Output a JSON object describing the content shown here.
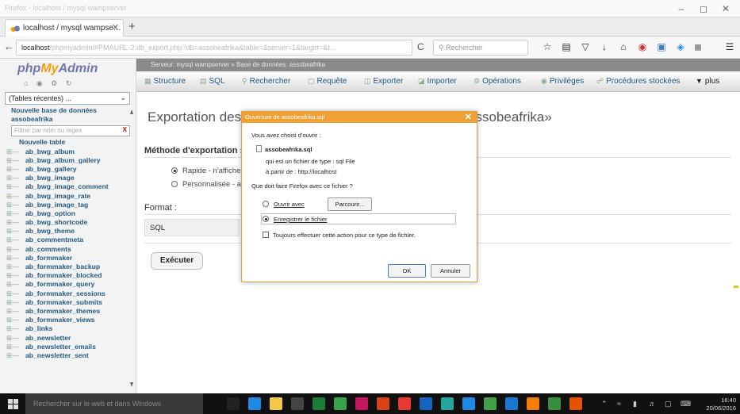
{
  "window": {
    "title": "Firefox - localhost / mysql wampserver",
    "controls": [
      "–",
      "◻",
      "✕"
    ]
  },
  "tab": {
    "title": "localhost / mysql wampse…",
    "close": "✕",
    "new_tab": "+"
  },
  "nav": {
    "back": "←",
    "url_host": "localhost",
    "url_rest": "/phpmyadmin/#PMAURL-2:db_export.php?db=assobeafrika&table=&server=1&target=&t…",
    "reload": "C",
    "search_placeholder": "Rechercher",
    "toolbar_icons": [
      "star-icon",
      "library-icon",
      "pocket-icon",
      "download-icon",
      "home-icon",
      "extension-icon",
      "extension2-icon",
      "extension3-icon",
      "menu-icon"
    ]
  },
  "sidebar": {
    "logo_php": "php",
    "logo_my": "My",
    "logo_admin": "Admin",
    "recent_label": "(Tables récentes) ...",
    "recent_chev": "⌄",
    "new_db": "Nouvelle base de données",
    "db_name": "assobeafrika",
    "filter_placeholder": "Filtrer par nom ou regex",
    "filter_clear": "X",
    "new_table": "Nouvelle table",
    "tables": [
      "ab_bwg_album",
      "ab_bwg_album_gallery",
      "ab_bwg_gallery",
      "ab_bwg_image",
      "ab_bwg_image_comment",
      "ab_bwg_image_rate",
      "ab_bwg_image_tag",
      "ab_bwg_option",
      "ab_bwg_shortcode",
      "ab_bwg_theme",
      "ab_commentmeta",
      "ab_comments",
      "ab_formmaker",
      "ab_formmaker_backup",
      "ab_formmaker_blocked",
      "ab_formmaker_query",
      "ab_formmaker_sessions",
      "ab_formmaker_submits",
      "ab_formmaker_themes",
      "ab_formmaker_views",
      "ab_links",
      "ab_newsletter",
      "ab_newsletter_emails",
      "ab_newsletter_sent"
    ]
  },
  "main": {
    "breadcrumb": "Serveur: mysql wampserver » Base de données: assobeafrika",
    "tabs": [
      {
        "label": "Structure",
        "icon": "structure-icon"
      },
      {
        "label": "SQL",
        "icon": "sql-icon"
      },
      {
        "label": "Rechercher",
        "icon": "search-icon"
      },
      {
        "label": "Requête",
        "icon": "query-icon"
      },
      {
        "label": "Exporter",
        "icon": "export-icon"
      },
      {
        "label": "Importer",
        "icon": "import-icon"
      },
      {
        "label": "Opérations",
        "icon": "operations-icon"
      },
      {
        "label": "Privilèges",
        "icon": "privileges-icon"
      },
      {
        "label": "Procédures stockées",
        "icon": "procedures-icon"
      },
      {
        "label": "plus",
        "icon": "more-icon"
      }
    ],
    "title_left": "Exportation des",
    "title_right": "assobeafrika»",
    "export_method_label": "Méthode d'exportation :",
    "radio_quick": "Rapide - n'afficher",
    "radio_custom": "Personnalisée - aff",
    "format_label": "Format :",
    "format_value": "SQL",
    "execute_button": "Exécuter"
  },
  "dialog": {
    "title": "Ouverture de assobeafrika.sql",
    "close": "✕",
    "intro": "Vous avez choisi d'ouvrir :",
    "filename": "assobeafrika.sql",
    "type_line": "qui est un fichier de type : sql File",
    "from_line": "à partir de : http://localhost",
    "question": "Que doit faire Firefox avec ce fichier ?",
    "open_with": "Ouvrir avec",
    "browse": "Parcourir...",
    "save_file": "Enregistrer le fichier",
    "always": "Toujours effectuer cette action pour ce type de fichier.",
    "ok": "OK",
    "cancel": "Annuler"
  },
  "taskbar": {
    "search": "Rechercher sur le web et dans Windows",
    "time": "16:40",
    "date": "20/06/2016",
    "apps": [
      "task-view-icon",
      "edge-icon",
      "file-explorer-icon",
      "store-icon",
      "excel-icon",
      "dreamweaver-icon",
      "indesign-icon",
      "powerpoint-icon",
      "app-icon",
      "word-icon",
      "app2-icon",
      "skype-icon",
      "chrome-icon",
      "app3-icon",
      "app4-icon",
      "app5-icon",
      "firefox-icon"
    ],
    "app_colors": [
      "#222",
      "#1e88e5",
      "#f2c84b",
      "#444",
      "#1d7a3a",
      "#35a34a",
      "#c2185b",
      "#d84315",
      "#e53935",
      "#1565c0",
      "#26a69a",
      "#1e88e5",
      "#43a047",
      "#1976d2",
      "#f57c00",
      "#388e3c",
      "#e65100"
    ],
    "tray_icons": [
      "chevron-up-icon",
      "network-icon",
      "battery-icon",
      "speaker-icon",
      "notification-icon",
      "keyboard-icon"
    ]
  }
}
